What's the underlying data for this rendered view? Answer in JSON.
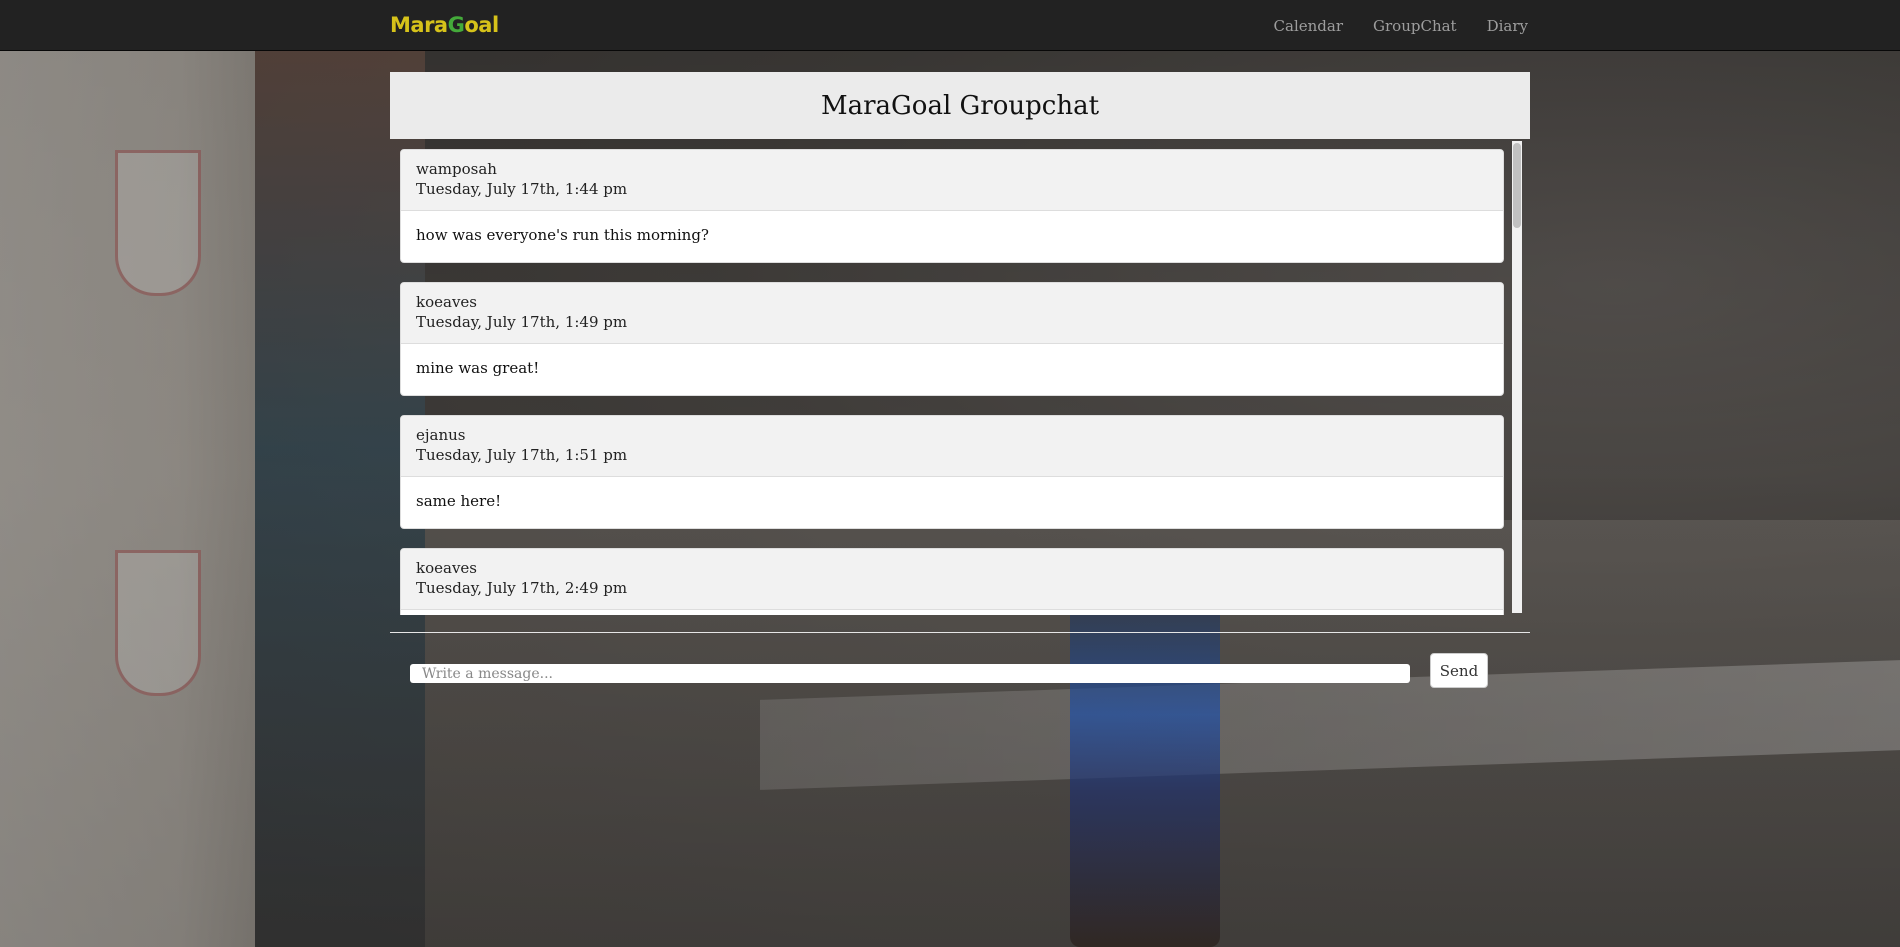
{
  "navbar": {
    "logo": {
      "part1": "Mara",
      "part2": "G",
      "part3": "oal"
    },
    "links": [
      {
        "label": "Calendar"
      },
      {
        "label": "GroupChat"
      },
      {
        "label": "Diary"
      }
    ]
  },
  "chat": {
    "title": "MaraGoal Groupchat",
    "messages": [
      {
        "user": "wamposah",
        "time": "Tuesday, July 17th, 1:44 pm",
        "text": "how was everyone's run this morning?"
      },
      {
        "user": "koeaves",
        "time": "Tuesday, July 17th, 1:49 pm",
        "text": "mine was great!"
      },
      {
        "user": "ejanus",
        "time": "Tuesday, July 17th, 1:51 pm",
        "text": "same here!"
      },
      {
        "user": "koeaves",
        "time": "Tuesday, July 17th, 2:49 pm",
        "text": ""
      }
    ]
  },
  "compose": {
    "placeholder": "Write a message...",
    "send_label": "Send"
  },
  "colors": {
    "navbar_bg": "#222222",
    "nav_link": "#9d9d9d",
    "logo_yellow": "#d6c21a",
    "logo_green": "#44aa3a",
    "header_bg": "#ebebeb",
    "message_head_bg": "#f2f2f2"
  }
}
